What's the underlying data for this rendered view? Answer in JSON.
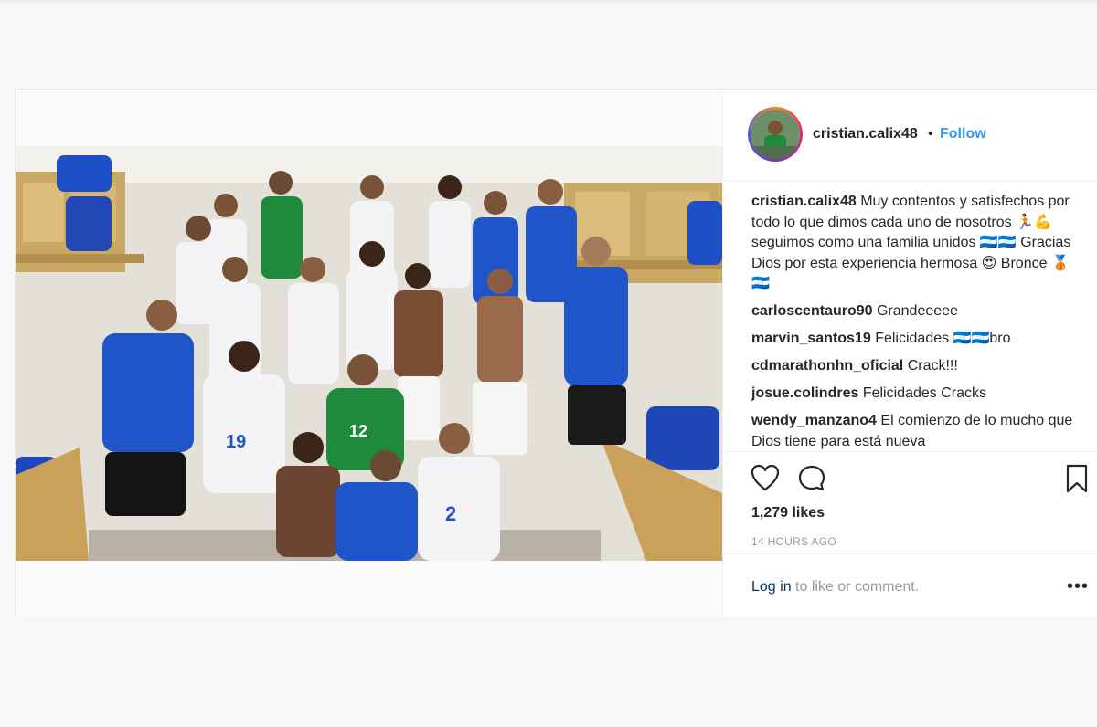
{
  "post": {
    "username": "cristian.calix48",
    "follow_label": "Follow",
    "separator": "•",
    "comments": [
      {
        "user": "cristian.calix48",
        "text": "Muy contentos y satisfechos por todo lo que dimos cada uno de nosotros 🏃💪 seguimos como una familia unidos 🇭🇳🇭🇳 Gracias Dios por esta experiencia hermosa 😍 Bronce 🥉🇭🇳"
      },
      {
        "user": "carloscentauro90",
        "text": "Grandeeeee"
      },
      {
        "user": "marvin_santos19",
        "text": "Felicidades 🇭🇳🇭🇳bro"
      },
      {
        "user": "cdmarathonhn_oficial",
        "text": "Crack!!!"
      },
      {
        "user": "josue.colindres",
        "text": "Felicidades Cracks"
      },
      {
        "user": "wendy_manzano4",
        "text": "El comienzo de lo mucho que Dios tiene para está nueva"
      }
    ],
    "likes": "1,279 likes",
    "time_ago": "14 HOURS AGO",
    "login_link": "Log in",
    "login_rest": " to like or comment.",
    "more_label": "•••"
  },
  "icons": {
    "like": "heart-icon",
    "comment": "comment-bubble-icon",
    "save": "bookmark-icon"
  },
  "colors": {
    "link_blue": "#3897f0",
    "kit_blue": "#1f55c8",
    "keeper_green": "#1f8a3c"
  }
}
